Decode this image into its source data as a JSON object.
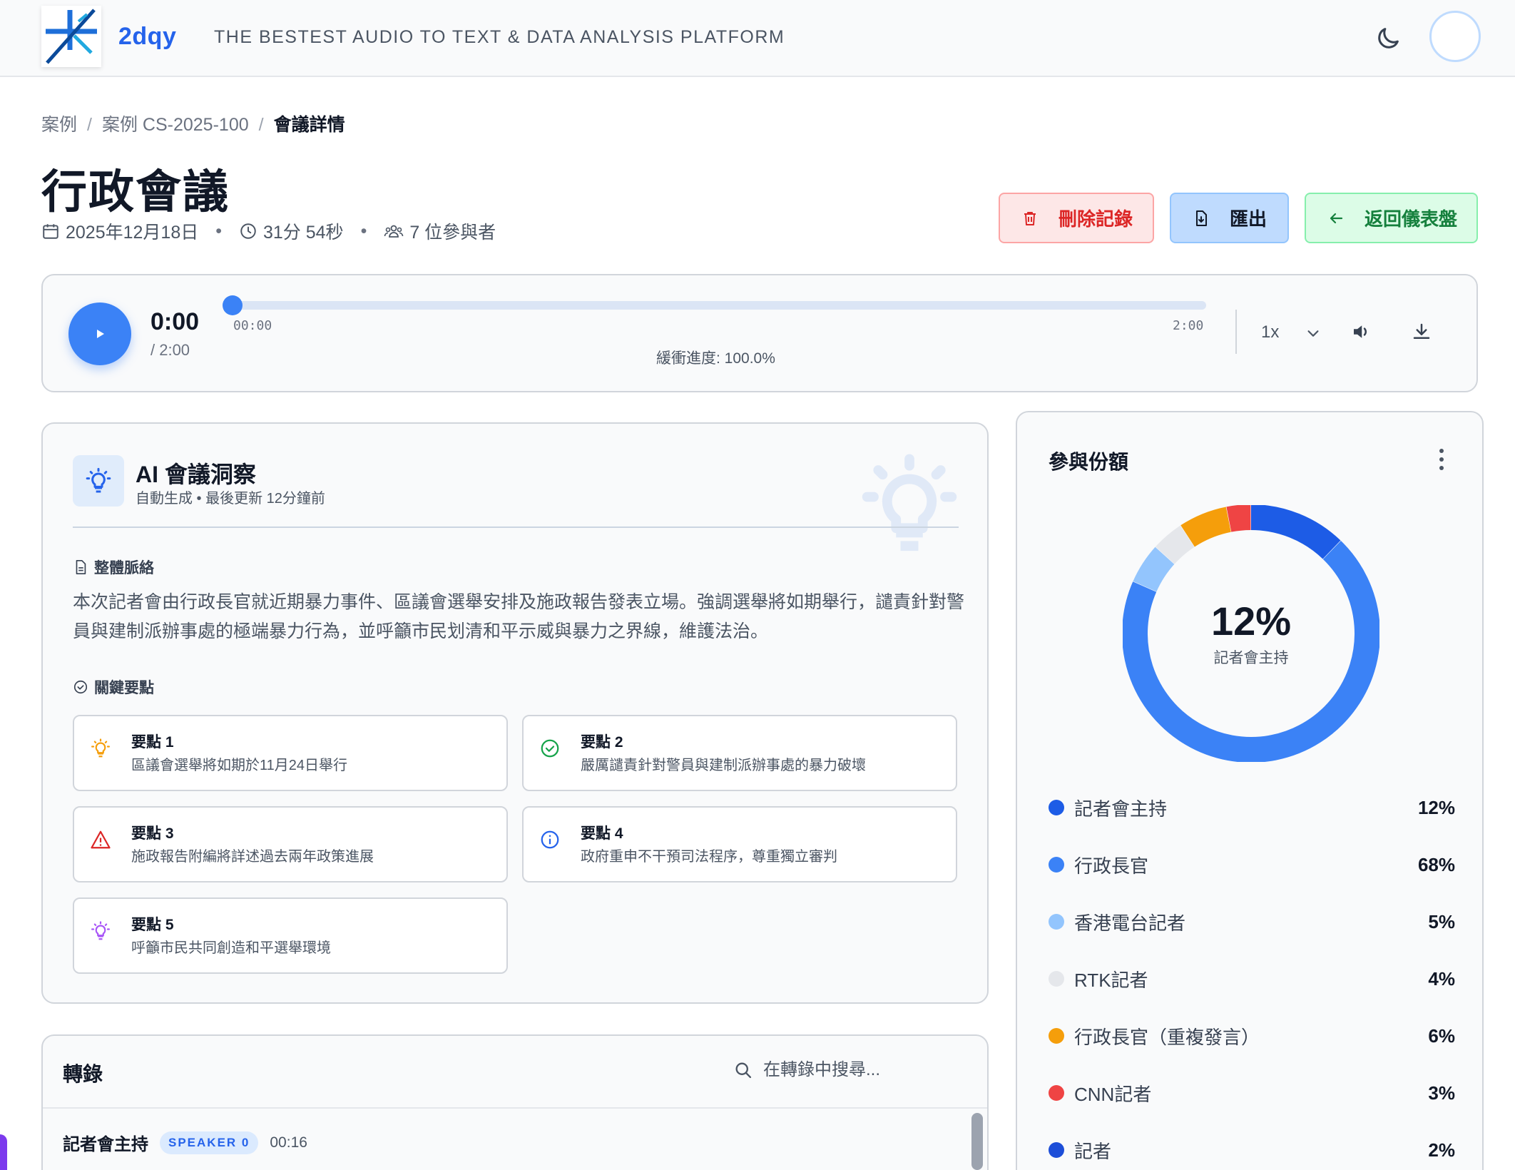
{
  "header": {
    "brand": "2dqy",
    "tagline": "THE BESTEST AUDIO TO TEXT & DATA ANALYSIS PLATFORM",
    "icons": [
      "logo-icon",
      "moon-icon",
      "avatar"
    ]
  },
  "breadcrumb": [
    "案例",
    "案例 CS-2025-100",
    "會議詳情"
  ],
  "meeting": {
    "title": "行政會議",
    "date": "2025年12月18日",
    "duration": "31分 54秒",
    "participants": "7 位參與者"
  },
  "actions": {
    "delete": "刪除記錄",
    "export": "匯出",
    "back": "返回儀表盤"
  },
  "player": {
    "current_time": "0:00",
    "total_time": "/ 2:00",
    "start_label": "00:00",
    "end_label": "2:00",
    "progress": 0,
    "buffer": "緩衝進度: 100.0%",
    "speed": "1x"
  },
  "insights": {
    "title": "AI 會議洞察",
    "subtitle": "自動生成 • 最後更新 12分鐘前",
    "context_heading": "整體脈絡",
    "summary": "本次記者會由行政長官就近期暴力事件、區議會選舉安排及施政報告發表立場。強調選舉將如期舉行，譴責針對警員與建制派辦事處的極端暴力行為，並呼籲市民划清和平示威與暴力之界線，維護法治。",
    "points_heading": "關鍵要點",
    "points": [
      {
        "title": "要點 1",
        "text": "區議會選舉將如期於11月24日舉行",
        "icon": "lightbulb-icon",
        "color": "#f59e0b"
      },
      {
        "title": "要點 2",
        "text": "嚴厲譴責針對警員與建制派辦事處的暴力破壞",
        "icon": "check-circle-icon",
        "color": "#16a34a"
      },
      {
        "title": "要點 3",
        "text": "施政報告附編將詳述過去兩年政策進展",
        "icon": "warning-icon",
        "color": "#dc2626"
      },
      {
        "title": "要點 4",
        "text": "政府重申不干預司法程序，尊重獨立審判",
        "icon": "info-icon",
        "color": "#2563eb"
      },
      {
        "title": "要點 5",
        "text": "呼籲市民共同創造和平選舉環境",
        "icon": "lightbulb-icon",
        "color": "#a855f7"
      }
    ]
  },
  "transcript": {
    "title": "轉錄",
    "search_placeholder": "在轉錄中搜尋...",
    "first_entry": {
      "speaker": "記者會主持",
      "badge": "SPEAKER 0",
      "time": "00:16"
    }
  },
  "share": {
    "title": "參與份額",
    "center_value": "12%",
    "center_label": "記者會主持",
    "legend": [
      {
        "name": "記者會主持",
        "pct": "12%",
        "value": 12,
        "color": "#1d5ce6"
      },
      {
        "name": "行政長官",
        "pct": "68%",
        "value": 68,
        "color": "#3b82f6"
      },
      {
        "name": "香港電台記者",
        "pct": "5%",
        "value": 5,
        "color": "#93c5fd"
      },
      {
        "name": "RTK記者",
        "pct": "4%",
        "value": 4,
        "color": "#e5e7eb"
      },
      {
        "name": "行政長官（重複發言）",
        "pct": "6%",
        "value": 6,
        "color": "#f59e0b"
      },
      {
        "name": "CNN記者",
        "pct": "3%",
        "value": 3,
        "color": "#ef4444"
      },
      {
        "name": "記者",
        "pct": "2%",
        "value": 2,
        "color": "#1d4ed8"
      }
    ]
  }
}
